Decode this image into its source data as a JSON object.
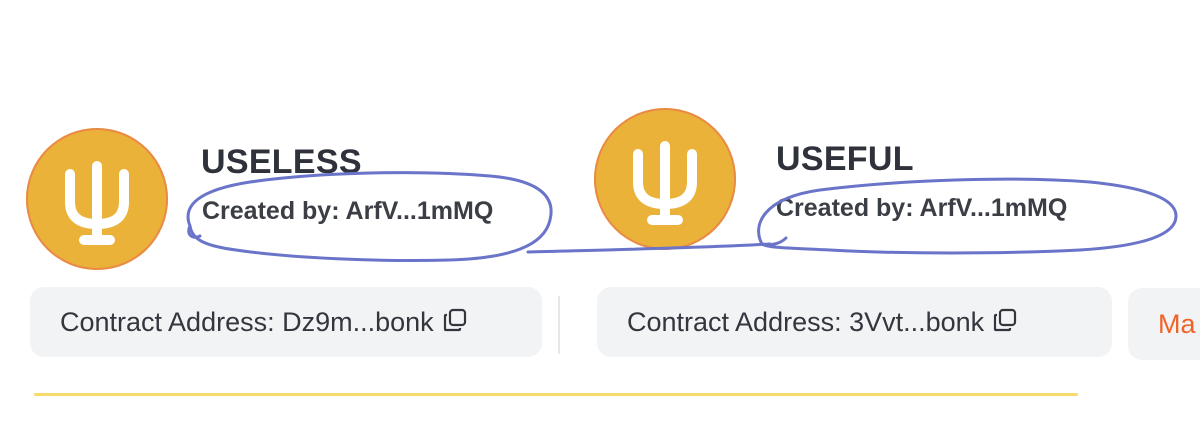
{
  "tokens": [
    {
      "name": "USELESS",
      "created_by": "Created by: ArfV...1mMQ",
      "contract_address": "Contract Address: Dz9m...bonk"
    },
    {
      "name": "USEFUL",
      "created_by": "Created by: ArfV...1mMQ",
      "contract_address": "Contract Address: 3Vvt...bonk"
    }
  ],
  "partial_button_label": "Ma",
  "colors": {
    "avatar_fill": "#ebb23a",
    "avatar_border": "#e98a45",
    "annotation_stroke": "#6a74c9",
    "partial_accent": "#f0642a"
  },
  "icons": [
    "token-logo-icon",
    "copy-icon"
  ]
}
